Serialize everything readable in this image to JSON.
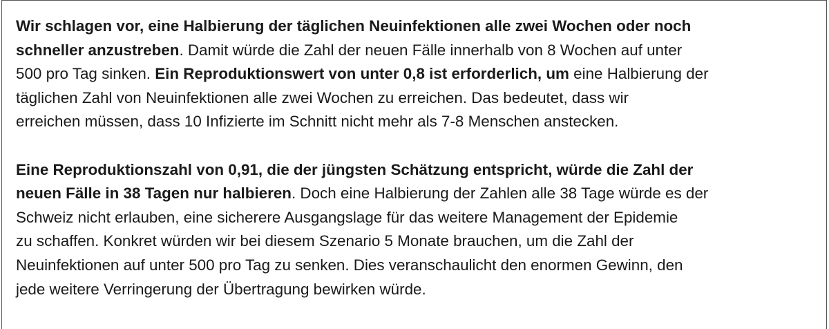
{
  "paragraphs": [
    {
      "lines": [
        [
          {
            "text": "Wir schlagen vor, eine Halbierung der täglichen Neuinfektionen alle zwei Wochen oder noch",
            "bold": true
          }
        ],
        [
          {
            "text": "schneller anzustreben",
            "bold": true
          },
          {
            "text": ". Damit würde die Zahl der neuen Fälle innerhalb von 8 Wochen auf unter",
            "bold": false
          }
        ],
        [
          {
            "text": "500 pro Tag sinken. ",
            "bold": false
          },
          {
            "text": "Ein Reproduktionswert von unter 0,8 ist erforderlich, um",
            "bold": true
          },
          {
            "text": " eine Halbierung der",
            "bold": false
          }
        ],
        [
          {
            "text": "täglichen Zahl von Neuinfektionen alle zwei Wochen zu erreichen. Das bedeutet, dass wir",
            "bold": false
          }
        ],
        [
          {
            "text": "erreichen müssen, dass 10 Infizierte im Schnitt nicht mehr als 7-8 Menschen anstecken.",
            "bold": false
          }
        ]
      ]
    },
    {
      "lines": [
        [
          {
            "text": "Eine Reproduktionszahl von 0,91, die der jüngsten Schätzung entspricht, würde die Zahl der",
            "bold": true
          }
        ],
        [
          {
            "text": "neuen Fälle in 38 Tagen nur halbieren",
            "bold": true
          },
          {
            "text": ". Doch eine Halbierung der Zahlen alle 38 Tage würde es der",
            "bold": false
          }
        ],
        [
          {
            "text": "Schweiz nicht erlauben, eine sicherere Ausgangslage für das weitere Management der Epidemie",
            "bold": false
          }
        ],
        [
          {
            "text": "zu schaffen. Konkret würden wir bei diesem Szenario 5 Monate brauchen, um die Zahl der",
            "bold": false
          }
        ],
        [
          {
            "text": "Neuinfektionen auf unter 500 pro Tag zu senken. Dies veranschaulicht den enormen Gewinn, den",
            "bold": false
          }
        ],
        [
          {
            "text": "jede weitere Verringerung der Übertragung bewirken würde.",
            "bold": false
          }
        ]
      ]
    }
  ]
}
